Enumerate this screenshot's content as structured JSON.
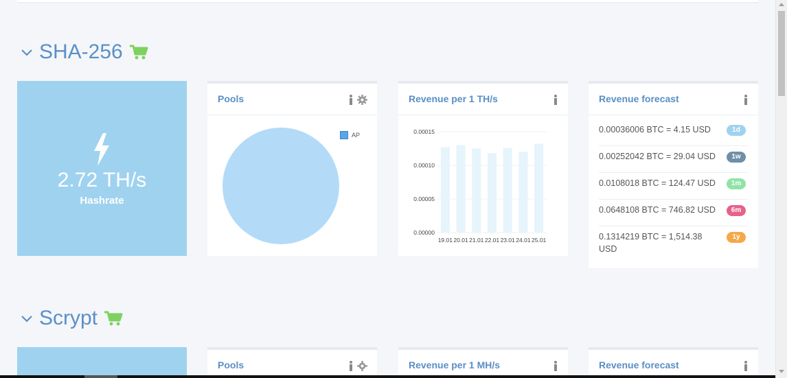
{
  "sections": [
    {
      "title": "SHA-256",
      "hashrate_value": "2.72 TH/s",
      "hashrate_label": "Hashrate",
      "pools_title": "Pools",
      "pools_legend": "AP",
      "revenue_title": "Revenue per 1 TH/s",
      "forecast_title": "Revenue forecast"
    },
    {
      "title": "Scrypt",
      "pools_title": "Pools",
      "revenue_title": "Revenue per 1 MH/s",
      "forecast_title": "Revenue forecast"
    }
  ],
  "forecast": [
    {
      "text": "0.00036006 BTC = 4.15 USD",
      "badge": "1d",
      "color": "#9fd2ef"
    },
    {
      "text": "0.00252042 BTC = 29.04 USD",
      "badge": "1w",
      "color": "#6f8fa8"
    },
    {
      "text": "0.0108018 BTC = 124.47 USD",
      "badge": "1m",
      "color": "#8fe3a6"
    },
    {
      "text": "0.0648108 BTC = 746.82 USD",
      "badge": "6m",
      "color": "#e6628a"
    },
    {
      "text": "0.1314219 BTC = 1,514.38 USD",
      "badge": "1y",
      "color": "#f5a84a"
    }
  ],
  "colors": {
    "accent": "#5b8fc7",
    "cart": "#7ed15f",
    "tile": "#9fd2ef",
    "pie": "#b3dbf8",
    "bar": "#e6f4fc"
  },
  "chart_data": {
    "type": "bar",
    "categories": [
      "19.01",
      "20.01",
      "21.01",
      "22.01",
      "23.01",
      "24.01",
      "25.01"
    ],
    "values": [
      0.000127,
      0.00013,
      0.000125,
      0.000118,
      0.000126,
      0.00012,
      0.000132
    ],
    "ylim": [
      0,
      0.00015
    ],
    "yticks": [
      "0.00015",
      "0.00010",
      "0.00005",
      "0.00000"
    ],
    "grid": true
  }
}
